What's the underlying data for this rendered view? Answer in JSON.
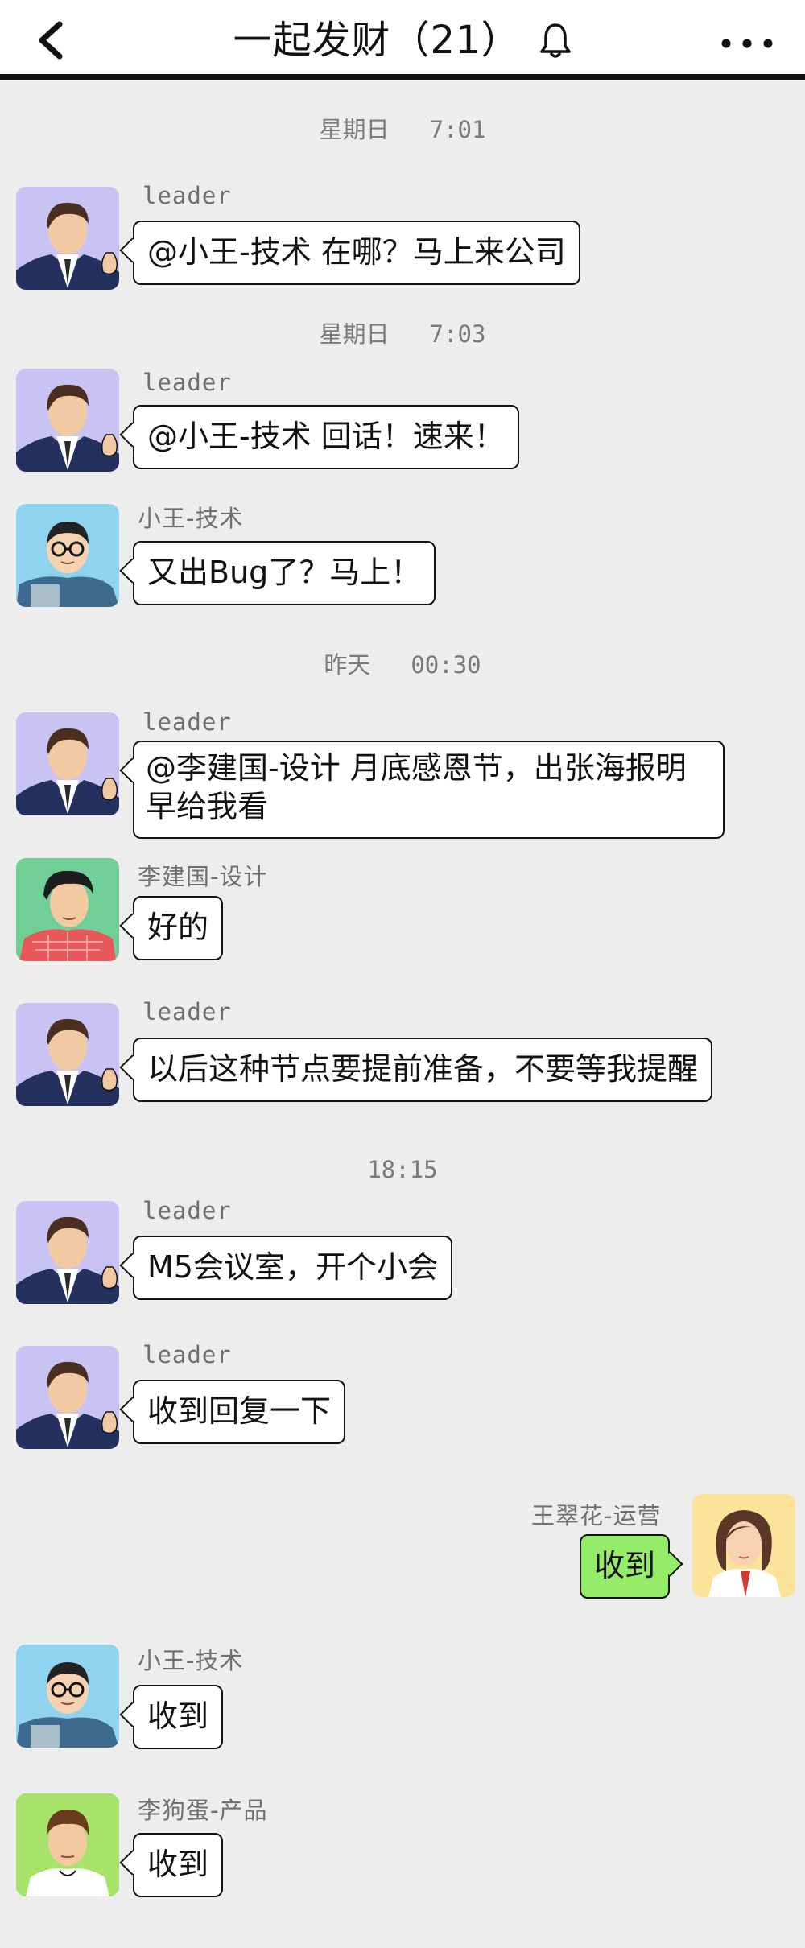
{
  "header": {
    "title": "一起发财（21）",
    "icons": {
      "back": "chevron-left-icon",
      "mute": "bell-icon",
      "more": "more-horizontal-icon"
    }
  },
  "timestamps": [
    {
      "day": "星期日",
      "time": "7:01"
    },
    {
      "day": "星期日",
      "time": "7:03"
    },
    {
      "day": "昨天",
      "time": "00:30"
    },
    {
      "day": "",
      "time": "18:15"
    }
  ],
  "messages": [
    {
      "sender": "leader",
      "text": "@小王-技术 在哪？马上来公司"
    },
    {
      "sender": "leader",
      "text": "@小王-技术 回话！速来！"
    },
    {
      "sender": "小王-技术",
      "text": "又出Bug了？马上！"
    },
    {
      "sender": "leader",
      "text": "@李建国-设计 月底感恩节，出张海报明早给我看"
    },
    {
      "sender": "李建国-设计",
      "text": "好的"
    },
    {
      "sender": "leader",
      "text": "以后这种节点要提前准备，不要等我提醒"
    },
    {
      "sender": "leader",
      "text": "M5会议室，开个小会"
    },
    {
      "sender": "leader",
      "text": "收到回复一下"
    },
    {
      "sender": "王翠花-运营",
      "text": "收到"
    },
    {
      "sender": "小王-技术",
      "text": "收到"
    },
    {
      "sender": "李狗蛋-产品",
      "text": "收到"
    }
  ],
  "colors": {
    "chat_background": "#ededed",
    "own_bubble": "#95ec69",
    "other_bubble": "#ffffff",
    "avatar_leader_bg": "#c9c3f4",
    "avatar_xiaowang_bg": "#8fd3ee",
    "avatar_lijianguo_bg": "#6fcf97",
    "avatar_wangcuihua_bg": "#fbe39a",
    "avatar_ligoudan_bg": "#a7e36a"
  }
}
